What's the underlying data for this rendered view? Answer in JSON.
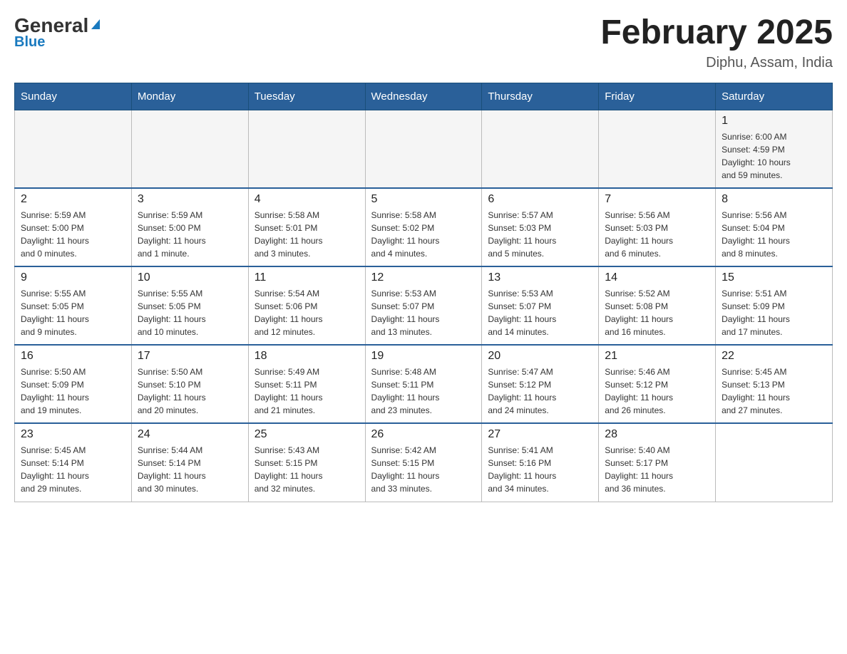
{
  "logo": {
    "general": "General",
    "blue": "Blue"
  },
  "title": "February 2025",
  "subtitle": "Diphu, Assam, India",
  "days_of_week": [
    "Sunday",
    "Monday",
    "Tuesday",
    "Wednesday",
    "Thursday",
    "Friday",
    "Saturday"
  ],
  "weeks": [
    [
      {
        "day": "",
        "info": ""
      },
      {
        "day": "",
        "info": ""
      },
      {
        "day": "",
        "info": ""
      },
      {
        "day": "",
        "info": ""
      },
      {
        "day": "",
        "info": ""
      },
      {
        "day": "",
        "info": ""
      },
      {
        "day": "1",
        "info": "Sunrise: 6:00 AM\nSunset: 4:59 PM\nDaylight: 10 hours\nand 59 minutes."
      }
    ],
    [
      {
        "day": "2",
        "info": "Sunrise: 5:59 AM\nSunset: 5:00 PM\nDaylight: 11 hours\nand 0 minutes."
      },
      {
        "day": "3",
        "info": "Sunrise: 5:59 AM\nSunset: 5:00 PM\nDaylight: 11 hours\nand 1 minute."
      },
      {
        "day": "4",
        "info": "Sunrise: 5:58 AM\nSunset: 5:01 PM\nDaylight: 11 hours\nand 3 minutes."
      },
      {
        "day": "5",
        "info": "Sunrise: 5:58 AM\nSunset: 5:02 PM\nDaylight: 11 hours\nand 4 minutes."
      },
      {
        "day": "6",
        "info": "Sunrise: 5:57 AM\nSunset: 5:03 PM\nDaylight: 11 hours\nand 5 minutes."
      },
      {
        "day": "7",
        "info": "Sunrise: 5:56 AM\nSunset: 5:03 PM\nDaylight: 11 hours\nand 6 minutes."
      },
      {
        "day": "8",
        "info": "Sunrise: 5:56 AM\nSunset: 5:04 PM\nDaylight: 11 hours\nand 8 minutes."
      }
    ],
    [
      {
        "day": "9",
        "info": "Sunrise: 5:55 AM\nSunset: 5:05 PM\nDaylight: 11 hours\nand 9 minutes."
      },
      {
        "day": "10",
        "info": "Sunrise: 5:55 AM\nSunset: 5:05 PM\nDaylight: 11 hours\nand 10 minutes."
      },
      {
        "day": "11",
        "info": "Sunrise: 5:54 AM\nSunset: 5:06 PM\nDaylight: 11 hours\nand 12 minutes."
      },
      {
        "day": "12",
        "info": "Sunrise: 5:53 AM\nSunset: 5:07 PM\nDaylight: 11 hours\nand 13 minutes."
      },
      {
        "day": "13",
        "info": "Sunrise: 5:53 AM\nSunset: 5:07 PM\nDaylight: 11 hours\nand 14 minutes."
      },
      {
        "day": "14",
        "info": "Sunrise: 5:52 AM\nSunset: 5:08 PM\nDaylight: 11 hours\nand 16 minutes."
      },
      {
        "day": "15",
        "info": "Sunrise: 5:51 AM\nSunset: 5:09 PM\nDaylight: 11 hours\nand 17 minutes."
      }
    ],
    [
      {
        "day": "16",
        "info": "Sunrise: 5:50 AM\nSunset: 5:09 PM\nDaylight: 11 hours\nand 19 minutes."
      },
      {
        "day": "17",
        "info": "Sunrise: 5:50 AM\nSunset: 5:10 PM\nDaylight: 11 hours\nand 20 minutes."
      },
      {
        "day": "18",
        "info": "Sunrise: 5:49 AM\nSunset: 5:11 PM\nDaylight: 11 hours\nand 21 minutes."
      },
      {
        "day": "19",
        "info": "Sunrise: 5:48 AM\nSunset: 5:11 PM\nDaylight: 11 hours\nand 23 minutes."
      },
      {
        "day": "20",
        "info": "Sunrise: 5:47 AM\nSunset: 5:12 PM\nDaylight: 11 hours\nand 24 minutes."
      },
      {
        "day": "21",
        "info": "Sunrise: 5:46 AM\nSunset: 5:12 PM\nDaylight: 11 hours\nand 26 minutes."
      },
      {
        "day": "22",
        "info": "Sunrise: 5:45 AM\nSunset: 5:13 PM\nDaylight: 11 hours\nand 27 minutes."
      }
    ],
    [
      {
        "day": "23",
        "info": "Sunrise: 5:45 AM\nSunset: 5:14 PM\nDaylight: 11 hours\nand 29 minutes."
      },
      {
        "day": "24",
        "info": "Sunrise: 5:44 AM\nSunset: 5:14 PM\nDaylight: 11 hours\nand 30 minutes."
      },
      {
        "day": "25",
        "info": "Sunrise: 5:43 AM\nSunset: 5:15 PM\nDaylight: 11 hours\nand 32 minutes."
      },
      {
        "day": "26",
        "info": "Sunrise: 5:42 AM\nSunset: 5:15 PM\nDaylight: 11 hours\nand 33 minutes."
      },
      {
        "day": "27",
        "info": "Sunrise: 5:41 AM\nSunset: 5:16 PM\nDaylight: 11 hours\nand 34 minutes."
      },
      {
        "day": "28",
        "info": "Sunrise: 5:40 AM\nSunset: 5:17 PM\nDaylight: 11 hours\nand 36 minutes."
      },
      {
        "day": "",
        "info": ""
      }
    ]
  ]
}
